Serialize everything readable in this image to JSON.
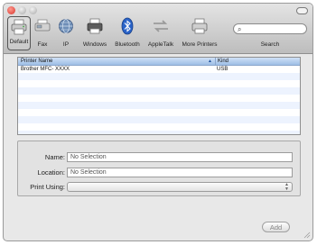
{
  "toolbar": {
    "items": [
      {
        "label": "Default",
        "icon": "default-printer-icon",
        "selected": true
      },
      {
        "label": "Fax",
        "icon": "fax-icon",
        "selected": false
      },
      {
        "label": "IP",
        "icon": "ip-globe-icon",
        "selected": false
      },
      {
        "label": "Windows",
        "icon": "windows-printer-icon",
        "selected": false
      },
      {
        "label": "Bluetooth",
        "icon": "bluetooth-icon",
        "selected": false
      },
      {
        "label": "AppleTalk",
        "icon": "appletalk-icon",
        "selected": false
      },
      {
        "label": "More Printers",
        "icon": "more-printers-icon",
        "selected": false
      }
    ],
    "search_label": "Search",
    "search_placeholder": ""
  },
  "printer_list": {
    "columns": [
      "Printer Name",
      "Kind"
    ],
    "rows": [
      {
        "name": "Brother MFC- XXXX",
        "kind": "USB"
      }
    ]
  },
  "details": {
    "name_label": "Name:",
    "name_value": "No Selection",
    "location_label": "Location:",
    "location_value": "No Selection",
    "print_using_label": "Print Using:",
    "print_using_value": ""
  },
  "add_button": "Add",
  "colors": {
    "header_blue": "#9ebfe6",
    "alt_row": "#edf3fe",
    "close_red": "#d8322a"
  }
}
